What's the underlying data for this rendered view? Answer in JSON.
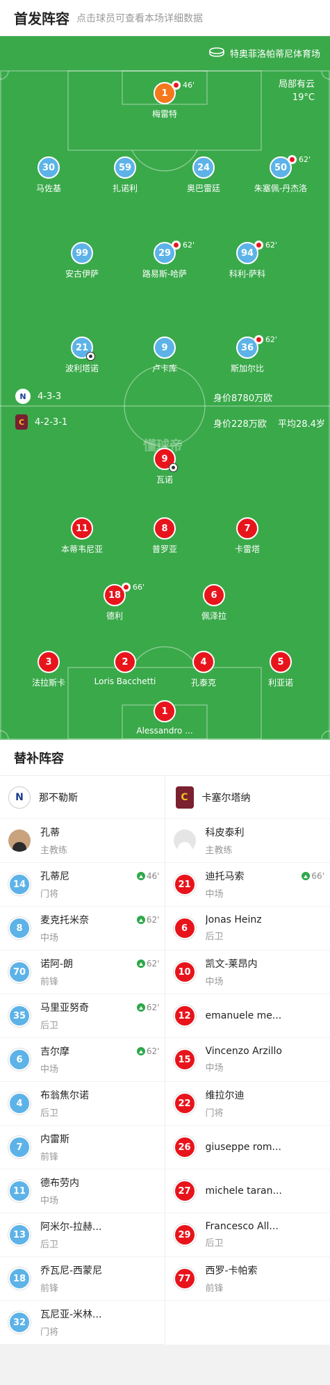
{
  "header": {
    "title": "首发阵容",
    "subtitle": "点击球员可查看本场详细数据"
  },
  "venue": "特奥菲洛帕蒂尼体育场",
  "weather": {
    "condition": "局部有云",
    "temp": "19°C"
  },
  "watermark": "懂球帝",
  "home_team": {
    "logo": "N",
    "formation": "4-3-3",
    "value": "身价8780万欧"
  },
  "away_team": {
    "logo": "C",
    "formation": "4-2-3-1",
    "value": "身价228万欧",
    "avg_age": "平均28.4岁"
  },
  "home_players": [
    {
      "num": "1",
      "name": "梅雷特",
      "sub": "46'"
    },
    {
      "num": "30",
      "name": "马佐基"
    },
    {
      "num": "59",
      "name": "扎诺利"
    },
    {
      "num": "24",
      "name": "奥巴雷廷"
    },
    {
      "num": "50",
      "name": "朱塞佩-丹杰洛",
      "sub": "62'"
    },
    {
      "num": "99",
      "name": "安古伊萨"
    },
    {
      "num": "29",
      "name": "路易斯-哈萨",
      "sub": "62'"
    },
    {
      "num": "94",
      "name": "科利-萨科",
      "sub": "62'"
    },
    {
      "num": "21",
      "name": "波利塔诺",
      "goal": true
    },
    {
      "num": "9",
      "name": "卢卡库"
    },
    {
      "num": "36",
      "name": "斯加尔比",
      "sub": "62'"
    }
  ],
  "away_players": [
    {
      "num": "9",
      "name": "瓦诺",
      "goal": true
    },
    {
      "num": "11",
      "name": "本蒂韦尼亚"
    },
    {
      "num": "8",
      "name": "普罗亚"
    },
    {
      "num": "7",
      "name": "卡雷塔"
    },
    {
      "num": "18",
      "name": "德利",
      "sub": "66'"
    },
    {
      "num": "6",
      "name": "佩泽拉"
    },
    {
      "num": "3",
      "name": "法拉斯卡"
    },
    {
      "num": "2",
      "name": "Loris Bacchetti"
    },
    {
      "num": "4",
      "name": "孔泰克"
    },
    {
      "num": "5",
      "name": "利亚诺"
    },
    {
      "num": "1",
      "name": "Alessandro ..."
    }
  ],
  "bench": {
    "title": "替补阵容",
    "home": {
      "team": "那不勒斯",
      "coach": {
        "name": "孔蒂",
        "role": "主教练"
      },
      "players": [
        {
          "num": "14",
          "name": "孔蒂尼",
          "pos": "门将",
          "min": "46'"
        },
        {
          "num": "8",
          "name": "麦克托米奈",
          "pos": "中场",
          "min": "62'"
        },
        {
          "num": "70",
          "name": "诺阿-朗",
          "pos": "前锋",
          "min": "62'"
        },
        {
          "num": "35",
          "name": "马里亚努奇",
          "pos": "后卫",
          "min": "62'"
        },
        {
          "num": "6",
          "name": "吉尔摩",
          "pos": "中场",
          "min": "62'"
        },
        {
          "num": "4",
          "name": "布翁焦尔诺",
          "pos": "后卫"
        },
        {
          "num": "7",
          "name": "内雷斯",
          "pos": "前锋"
        },
        {
          "num": "11",
          "name": "德布劳内",
          "pos": "中场"
        },
        {
          "num": "13",
          "name": "阿米尔-拉赫...",
          "pos": "后卫"
        },
        {
          "num": "18",
          "name": "乔瓦尼-西蒙尼",
          "pos": "前锋"
        },
        {
          "num": "32",
          "name": "瓦尼亚-米林...",
          "pos": "门将"
        }
      ]
    },
    "away": {
      "team": "卡塞尔塔纳",
      "coach": {
        "name": "科皮泰利",
        "role": "主教练"
      },
      "players": [
        {
          "num": "21",
          "name": "迪托马索",
          "pos": "中场",
          "min": "66'"
        },
        {
          "num": "6",
          "name": "Jonas Heinz",
          "pos": "后卫"
        },
        {
          "num": "10",
          "name": "凯文-莱昂内",
          "pos": "中场"
        },
        {
          "num": "12",
          "name": "emanuele me...",
          "pos": ""
        },
        {
          "num": "15",
          "name": "Vincenzo Arzillo",
          "pos": "中场"
        },
        {
          "num": "22",
          "name": "维拉尔迪",
          "pos": "门将"
        },
        {
          "num": "26",
          "name": "giuseppe rom...",
          "pos": ""
        },
        {
          "num": "27",
          "name": "michele taran...",
          "pos": ""
        },
        {
          "num": "29",
          "name": "Francesco All...",
          "pos": "后卫"
        },
        {
          "num": "77",
          "name": "西罗-卡帕索",
          "pos": "前锋"
        }
      ]
    }
  },
  "colors": {
    "pitch": "#3aa94a",
    "home": "#5db3e8",
    "away": "#e8141c",
    "gk_home": "#f4781c"
  }
}
